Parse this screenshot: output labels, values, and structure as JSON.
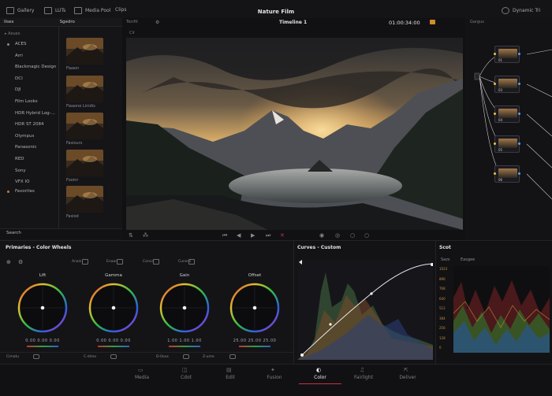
{
  "topbar": {
    "title": "Nature Film",
    "gallery": "Gallery",
    "luts": "LUTs",
    "media_pool": "Media Pool",
    "clips": "Clips",
    "dynamic": "Dynamic Tri"
  },
  "left_panel": {
    "header_tab1": "Ilsex",
    "header_tab2": "Sgedro",
    "filter_label": "Aouex",
    "items": [
      "ACES",
      "Arri",
      "Blackmagic Design",
      "DCI",
      "DJI",
      "Film Looks",
      "HDR Hybrid Log-...",
      "HDR ST 2084",
      "Olympus",
      "Panasonic",
      "RED",
      "Sony",
      "VFX IO"
    ],
    "favorites": "Favorites",
    "search": "Search",
    "thumbs": [
      "Fiaaon",
      "Fiaaone Linidis",
      "Fasiours",
      "Fooinr",
      "Fasiod"
    ]
  },
  "viewer": {
    "label_left": "Tenfit",
    "timeline": "Timeline 1",
    "timecode": "01:00:34:00",
    "clip": "Clr"
  },
  "nodes": {
    "label": "Gargus",
    "node_labels": [
      "01",
      "03",
      "04",
      "05",
      "06"
    ]
  },
  "primaries": {
    "title": "Primaries - Color Wheels",
    "toolbar": [
      "Anais",
      "Enaon",
      "Conca",
      "Cunsns"
    ],
    "wheels": [
      {
        "name": "Lift",
        "vals": "0.00  0.00  0.00"
      },
      {
        "name": "Gamma",
        "vals": "0.00  0.00  0.00"
      },
      {
        "name": "Gain",
        "vals": "1.00  1.00  1.00"
      },
      {
        "name": "Offset",
        "vals": "25.00  25.00  25.00"
      }
    ],
    "bottom": [
      "Cimatu",
      "C-dimo",
      "D-0ous",
      "Z-ume"
    ]
  },
  "curves": {
    "title": "Curves - Custom"
  },
  "scope": {
    "title": "Scot",
    "tabs": [
      "Sazs",
      "Easgee"
    ],
    "axis": [
      "1023",
      "896",
      "768",
      "640",
      "512",
      "384",
      "256",
      "128",
      "0"
    ]
  },
  "bottom_nav": [
    "Media",
    "Cdot",
    "Edit",
    "Fusion",
    "Color",
    "Fairlight",
    "Deliver"
  ],
  "colors": {
    "accent": "#c8323c",
    "wheel_red": "#e03030"
  }
}
